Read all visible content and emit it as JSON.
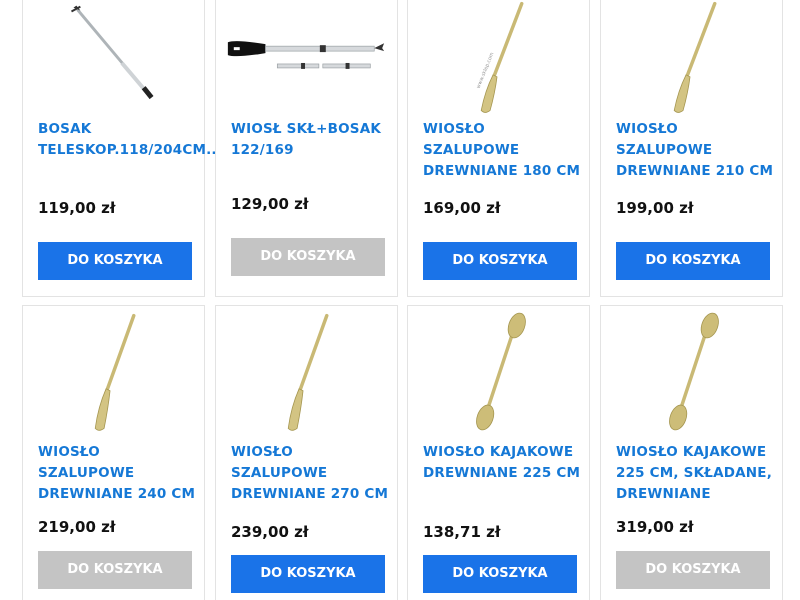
{
  "products": [
    {
      "title_line1": "BOSAK",
      "title_line2": "TELESKOP.118/204CM..",
      "title_line3": "",
      "price": "119,00 zł",
      "button": "DO KOSZYKA",
      "button_state": "active",
      "icon": "telescopic-boathook"
    },
    {
      "title_line1": "WIOSŁ SKŁ+BOSAK",
      "title_line2": "122/169",
      "title_line3": "",
      "price": "129,00 zł",
      "button": "DO KOSZYKA",
      "button_state": "inactive",
      "icon": "folding-paddle-boathook"
    },
    {
      "title_line1": "WIOSŁO SZALUPOWE",
      "title_line2": "DREWNIANE 180 CM",
      "title_line3": "",
      "price": "169,00 zł",
      "button": "DO KOSZYKA",
      "button_state": "active",
      "icon": "wooden-oar"
    },
    {
      "title_line1": "WIOSŁO SZALUPOWE",
      "title_line2": "DREWNIANE 210 CM",
      "title_line3": "",
      "price": "199,00 zł",
      "button": "DO KOSZYKA",
      "button_state": "active",
      "icon": "wooden-oar"
    },
    {
      "title_line1": "WIOSŁO SZALUPOWE",
      "title_line2": "DREWNIANE 240 CM",
      "title_line3": "",
      "price": "219,00 zł",
      "button": "DO KOSZYKA",
      "button_state": "inactive",
      "icon": "wooden-oar"
    },
    {
      "title_line1": "WIOSŁO SZALUPOWE",
      "title_line2": "DREWNIANE 270 CM",
      "title_line3": "",
      "price": "239,00 zł",
      "button": "DO KOSZYKA",
      "button_state": "active",
      "icon": "wooden-oar"
    },
    {
      "title_line1": "WIOSŁO KAJAKOWE",
      "title_line2": "DREWNIANE 225 CM",
      "title_line3": "",
      "price": "138,71 zł",
      "button": "DO KOSZYKA",
      "button_state": "active",
      "icon": "kayak-paddle"
    },
    {
      "title_line1": "WIOSŁO KAJAKOWE",
      "title_line2": "225 CM, SKŁADANE,",
      "title_line3": "DREWNIANE",
      "price": "319,00 zł",
      "button": "DO KOSZYKA",
      "button_state": "inactive",
      "icon": "kayak-paddle"
    }
  ],
  "colors": {
    "title": "#1578d6",
    "button_active": "#1a73e8",
    "button_inactive": "#c4c4c4",
    "price": "#111111",
    "wood": "#c9b975"
  }
}
